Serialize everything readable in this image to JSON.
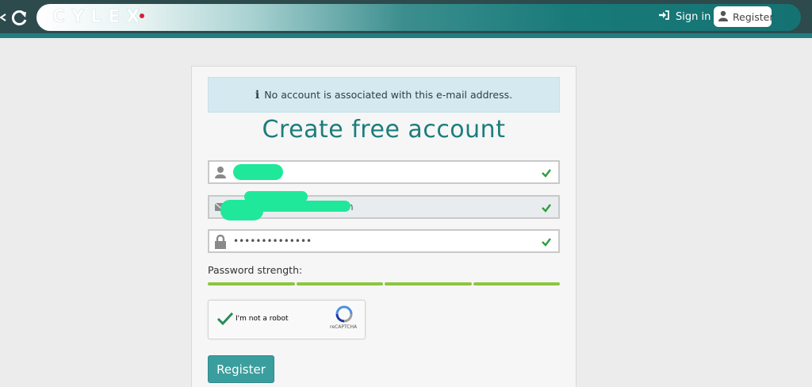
{
  "header": {
    "logo_text": "CYLEX",
    "signin_label": "Sign in",
    "register_label": "Register",
    "icons": {
      "back": "back-arrow-icon",
      "reload": "reload-icon",
      "signin": "sign-in-icon",
      "user": "user-icon"
    }
  },
  "alert": {
    "icon": "info-icon",
    "icon_glyph": "i",
    "text": "No account is associated with this e-mail address."
  },
  "form": {
    "title": "Create free account",
    "fields": [
      {
        "name": "name",
        "icon": "user-icon",
        "value": "",
        "valid": true
      },
      {
        "name": "email",
        "icon": "envelope-icon",
        "value": "bloga",
        "value_tail": "n",
        "valid": true
      },
      {
        "name": "password",
        "icon": "lock-icon",
        "value": "••••••••••••••",
        "valid": true
      }
    ],
    "password_strength_label": "Password strength:",
    "password_strength_segments": 4,
    "password_strength_level": 4,
    "captcha": {
      "label": "I'm not a robot",
      "brand": "reCAPTCHA",
      "checked": true
    },
    "submit_label": "Register"
  },
  "colors": {
    "accent": "#1c7d7d",
    "button": "#3b9e9e",
    "strength": "#8cc63f",
    "check": "#2e9e3e",
    "topbar": "#2d4a4d"
  }
}
